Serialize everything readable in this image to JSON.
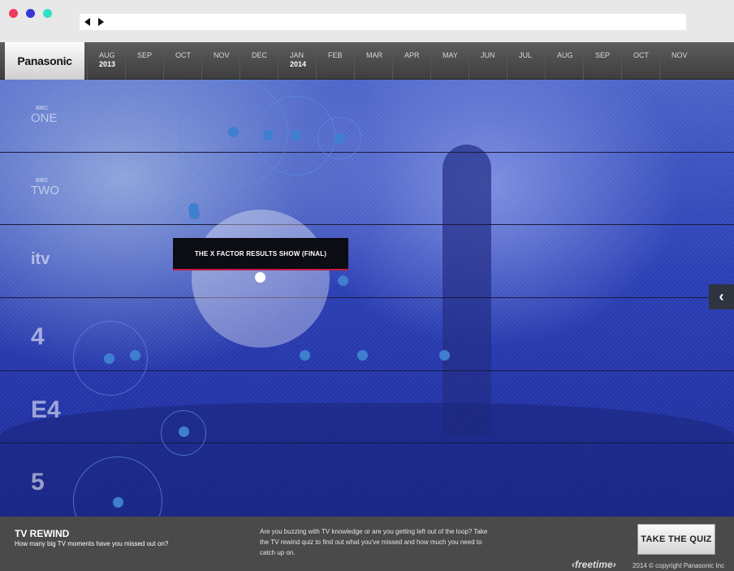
{
  "browser": {
    "window_dots": [
      "#f23a5c",
      "#3a36d9",
      "#33e0c4"
    ]
  },
  "brand": {
    "logo": "Panasonic"
  },
  "timeline": {
    "months": [
      {
        "label": "AUG",
        "year": "2013"
      },
      {
        "label": "SEP",
        "year": ""
      },
      {
        "label": "OCT",
        "year": ""
      },
      {
        "label": "NOV",
        "year": ""
      },
      {
        "label": "DEC",
        "year": ""
      },
      {
        "label": "JAN",
        "year": "2014"
      },
      {
        "label": "FEB",
        "year": ""
      },
      {
        "label": "MAR",
        "year": ""
      },
      {
        "label": "APR",
        "year": ""
      },
      {
        "label": "MAY",
        "year": ""
      },
      {
        "label": "JUN",
        "year": ""
      },
      {
        "label": "JUL",
        "year": ""
      },
      {
        "label": "AUG",
        "year": ""
      },
      {
        "label": "SEP",
        "year": ""
      },
      {
        "label": "OCT",
        "year": ""
      },
      {
        "label": "NOV",
        "year": ""
      }
    ]
  },
  "channels": [
    {
      "small": "BBC",
      "name": "ONE"
    },
    {
      "small": "BBC",
      "name": "TWO"
    },
    {
      "small": "",
      "name": "itv"
    },
    {
      "small": "",
      "name": "4"
    },
    {
      "small": "",
      "name": "E4"
    },
    {
      "small": "",
      "name": "5"
    }
  ],
  "tooltip": {
    "title": "THE X FACTOR RESULTS SHOW (FINAL)"
  },
  "footer": {
    "title": "TV REWIND",
    "subtitle": "How many big TV moments have you missed out on?",
    "body": "Are you buzzing with TV knowledge or are you getting left out of the loop? Take the TV rewind quiz to find out what you've missed and how much you need to catch up on.",
    "quiz_button": "TAKE THE QUIZ",
    "freetime_logo": "freetime",
    "copyright": "2014 © copyright Panasonic Inc"
  }
}
